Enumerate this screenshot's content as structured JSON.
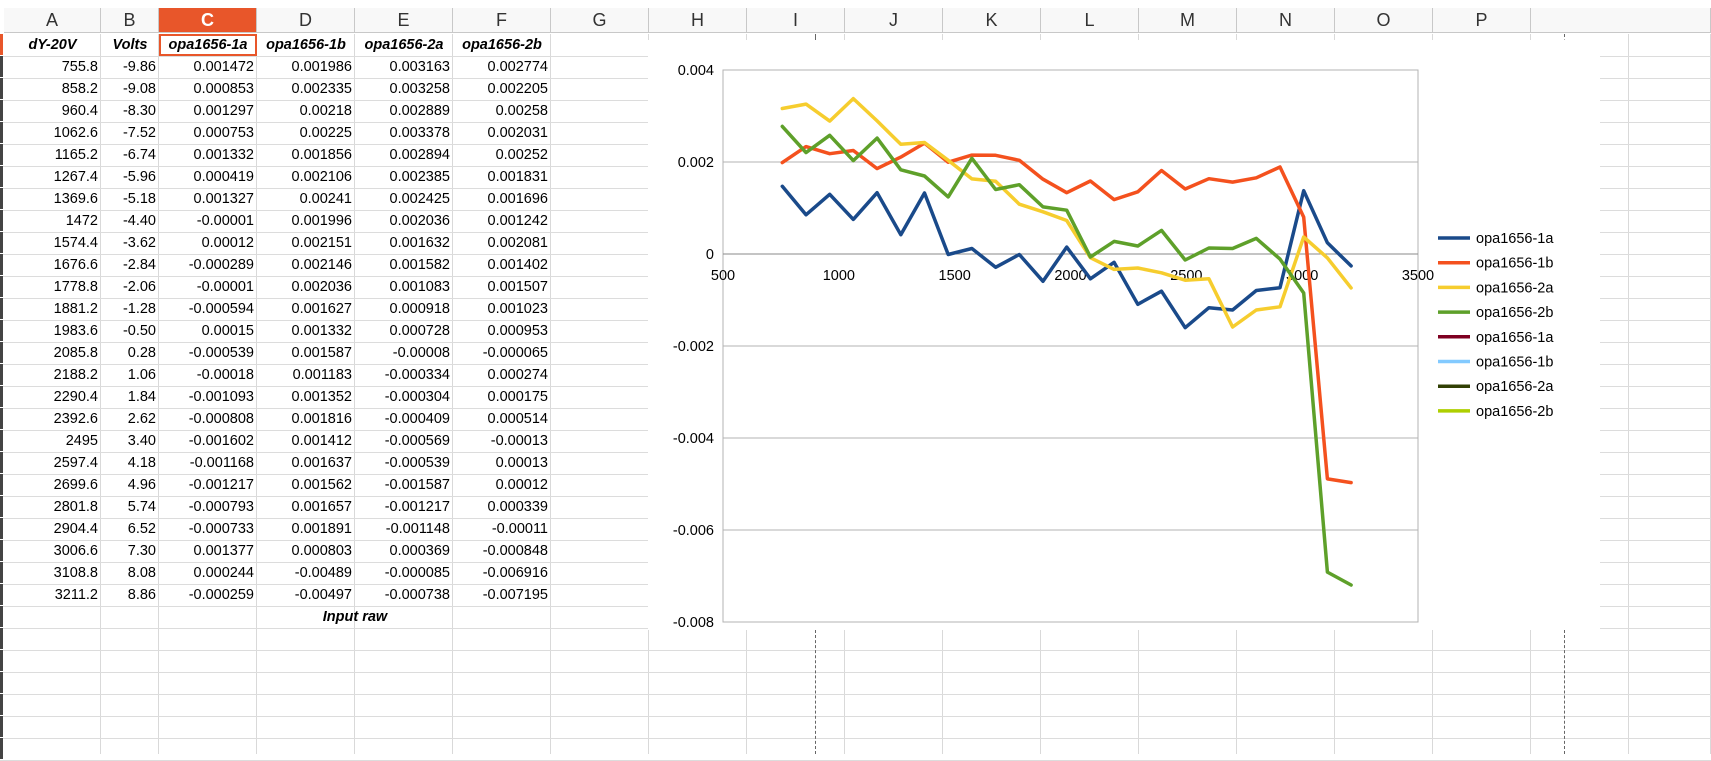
{
  "sheet": {
    "columns": [
      "A",
      "B",
      "C",
      "D",
      "E",
      "F",
      "G",
      "H",
      "I",
      "J",
      "K",
      "L",
      "M",
      "N",
      "O",
      "P"
    ],
    "active_column": "C",
    "headers": [
      "dY-20V",
      "Volts",
      "opa1656-1a",
      "opa1656-1b",
      "opa1656-2a",
      "opa1656-2b"
    ],
    "rows": [
      [
        "755.8",
        "-9.86",
        "0.001472",
        "0.001986",
        "0.003163",
        "0.002774"
      ],
      [
        "858.2",
        "-9.08",
        "0.000853",
        "0.002335",
        "0.003258",
        "0.002205"
      ],
      [
        "960.4",
        "-8.30",
        "0.001297",
        "0.00218",
        "0.002889",
        "0.00258"
      ],
      [
        "1062.6",
        "-7.52",
        "0.000753",
        "0.00225",
        "0.003378",
        "0.002031"
      ],
      [
        "1165.2",
        "-6.74",
        "0.001332",
        "0.001856",
        "0.002894",
        "0.00252"
      ],
      [
        "1267.4",
        "-5.96",
        "0.000419",
        "0.002106",
        "0.002385",
        "0.001831"
      ],
      [
        "1369.6",
        "-5.18",
        "0.001327",
        "0.00241",
        "0.002425",
        "0.001696"
      ],
      [
        "1472",
        "-4.40",
        "-0.00001",
        "0.001996",
        "0.002036",
        "0.001242"
      ],
      [
        "1574.4",
        "-3.62",
        "0.00012",
        "0.002151",
        "0.001632",
        "0.002081"
      ],
      [
        "1676.6",
        "-2.84",
        "-0.000289",
        "0.002146",
        "0.001582",
        "0.001402"
      ],
      [
        "1778.8",
        "-2.06",
        "-0.00001",
        "0.002036",
        "0.001083",
        "0.001507"
      ],
      [
        "1881.2",
        "-1.28",
        "-0.000594",
        "0.001627",
        "0.000918",
        "0.001023"
      ],
      [
        "1983.6",
        "-0.50",
        "0.00015",
        "0.001332",
        "0.000728",
        "0.000953"
      ],
      [
        "2085.8",
        "0.28",
        "-0.000539",
        "0.001587",
        "-0.00008",
        "-0.000065"
      ],
      [
        "2188.2",
        "1.06",
        "-0.00018",
        "0.001183",
        "-0.000334",
        "0.000274"
      ],
      [
        "2290.4",
        "1.84",
        "-0.001093",
        "0.001352",
        "-0.000304",
        "0.000175"
      ],
      [
        "2392.6",
        "2.62",
        "-0.000808",
        "0.001816",
        "-0.000409",
        "0.000514"
      ],
      [
        "2495",
        "3.40",
        "-0.001602",
        "0.001412",
        "-0.000569",
        "-0.00013"
      ],
      [
        "2597.4",
        "4.18",
        "-0.001168",
        "0.001637",
        "-0.000539",
        "0.00013"
      ],
      [
        "2699.6",
        "4.96",
        "-0.001217",
        "0.001562",
        "-0.001587",
        "0.00012"
      ],
      [
        "2801.8",
        "5.74",
        "-0.000793",
        "0.001657",
        "-0.001217",
        "0.000339"
      ],
      [
        "2904.4",
        "6.52",
        "-0.000733",
        "0.001891",
        "-0.001148",
        "-0.00011"
      ],
      [
        "3006.6",
        "7.30",
        "0.001377",
        "0.000803",
        "0.000369",
        "-0.000848"
      ],
      [
        "3108.8",
        "8.08",
        "0.000244",
        "-0.00489",
        "-0.000085",
        "-0.006916"
      ],
      [
        "3211.2",
        "8.86",
        "-0.000259",
        "-0.00497",
        "-0.000738",
        "-0.007195"
      ]
    ],
    "footer_label": "Input raw"
  },
  "colors": {
    "active_column": "#e8562a",
    "grid": "#d9d9d9",
    "chart_gridline": "#b3b3b3"
  },
  "chart_data": {
    "type": "line",
    "title": "",
    "xlabel": "",
    "ylabel": "",
    "xlim": [
      500,
      3500
    ],
    "ylim": [
      -0.008,
      0.004
    ],
    "x_ticks": [
      "500",
      "1000",
      "1500",
      "2000",
      "2500",
      "3000",
      "3500"
    ],
    "y_ticks": [
      "0.004",
      "0.002",
      "0",
      "-0.002",
      "-0.004",
      "-0.006",
      "-0.008"
    ],
    "grid": "horizontal",
    "legend_position": "right",
    "x": [
      755.8,
      858.2,
      960.4,
      1062.6,
      1165.2,
      1267.4,
      1369.6,
      1472,
      1574.4,
      1676.6,
      1778.8,
      1881.2,
      1983.6,
      2085.8,
      2188.2,
      2290.4,
      2392.6,
      2495,
      2597.4,
      2699.6,
      2801.8,
      2904.4,
      3006.6,
      3108.8,
      3211.2
    ],
    "series": [
      {
        "name": "opa1656-1a",
        "color": "#1a4a8a",
        "values": [
          0.001472,
          0.000853,
          0.001297,
          0.000753,
          0.001332,
          0.000419,
          0.001327,
          -1e-05,
          0.00012,
          -0.000289,
          -1e-05,
          -0.000594,
          0.00015,
          -0.000539,
          -0.00018,
          -0.001093,
          -0.000808,
          -0.001602,
          -0.001168,
          -0.001217,
          -0.000793,
          -0.000733,
          0.001377,
          0.000244,
          -0.000259
        ]
      },
      {
        "name": "opa1656-1b",
        "color": "#f4511e",
        "values": [
          0.001986,
          0.002335,
          0.00218,
          0.00225,
          0.001856,
          0.002106,
          0.00241,
          0.001996,
          0.002151,
          0.002146,
          0.002036,
          0.001627,
          0.001332,
          0.001587,
          0.001183,
          0.001352,
          0.001816,
          0.001412,
          0.001637,
          0.001562,
          0.001657,
          0.001891,
          0.000803,
          -0.00489,
          -0.00497
        ]
      },
      {
        "name": "opa1656-2a",
        "color": "#f6cd2e",
        "values": [
          0.003163,
          0.003258,
          0.002889,
          0.003378,
          0.002894,
          0.002385,
          0.002425,
          0.002036,
          0.001632,
          0.001582,
          0.001083,
          0.000918,
          0.000728,
          -8e-05,
          -0.000334,
          -0.000304,
          -0.000409,
          -0.000569,
          -0.000539,
          -0.001587,
          -0.001217,
          -0.001148,
          0.000369,
          -8.5e-05,
          -0.000738
        ]
      },
      {
        "name": "opa1656-2b",
        "color": "#5ea02a",
        "values": [
          0.002774,
          0.002205,
          0.00258,
          0.002031,
          0.00252,
          0.001831,
          0.001696,
          0.001242,
          0.002081,
          0.001402,
          0.001507,
          0.001023,
          0.000953,
          -6.5e-05,
          0.000274,
          0.000175,
          0.000514,
          -0.00013,
          0.00013,
          0.00012,
          0.000339,
          -0.00011,
          -0.000848,
          -0.006916,
          -0.007195
        ]
      },
      {
        "name": "opa1656-1a",
        "color": "#7e0021",
        "values": []
      },
      {
        "name": "opa1656-1b",
        "color": "#83caff",
        "values": []
      },
      {
        "name": "opa1656-2a",
        "color": "#314004",
        "values": []
      },
      {
        "name": "opa1656-2b",
        "color": "#aecf00",
        "values": []
      }
    ]
  }
}
